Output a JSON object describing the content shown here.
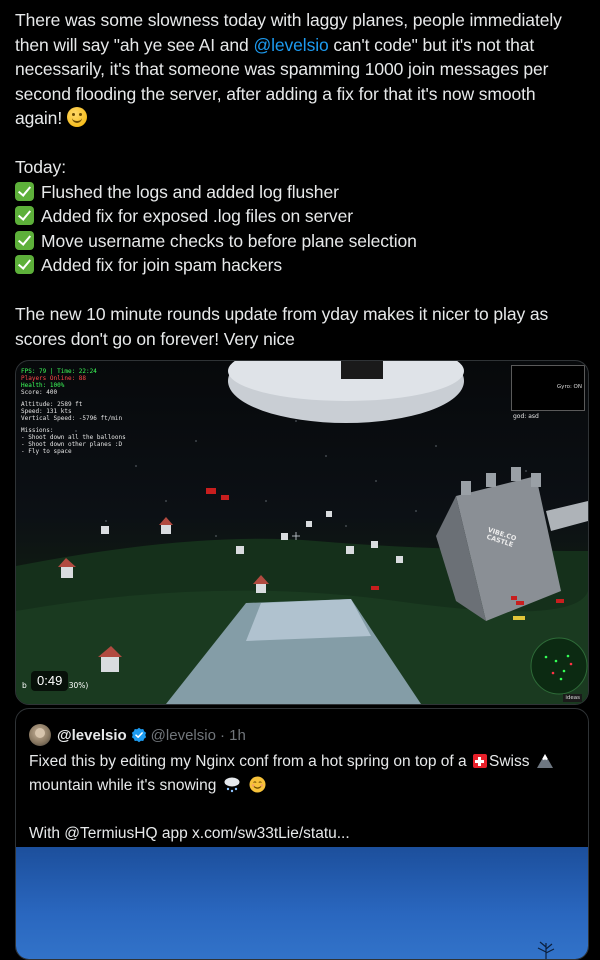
{
  "tweet": {
    "paragraph1_part1": "There was some slowness today with laggy planes, people immediately then will say \"ah ye see AI and ",
    "mention": "@levelsio",
    "paragraph1_part2": " can't code\" but it's not that necessarily, it's that someone was spamming 1000 join messages per second flooding the server, after adding a fix for that it's now smooth again! ",
    "emoji": "smiling-face-icon",
    "today_heading": "Today:",
    "checklist": [
      "Flushed the logs and added log flusher",
      "Added fix for exposed .log files on server",
      "Move username checks to before plane selection",
      "Added fix for join spam hackers"
    ],
    "paragraph3": "The new 10 minute rounds update from yday makes it nicer to play as scores don't go on forever! Very nice"
  },
  "video": {
    "duration": "0:49",
    "hud": {
      "fps_line": "FPS: 79 | Time: 22:24",
      "players_line": "Players Online: 88",
      "health_line": "Health: 100%",
      "score_line": "Score: 400",
      "altitude_line": "Altitude: 2589 ft",
      "speed_line": "Speed: 131 kts",
      "vspeed_line": "Vertical Speed: -5796 ft/min",
      "missions_title": "Missions:",
      "missions": [
        "- Shoot down all the balloons",
        "- Shoot down other planes :D",
        "- Fly to space"
      ]
    },
    "gyro_label": "Gyro: ON",
    "god_label": "god: asd",
    "castle_label_line1": "VIBE.CO",
    "castle_label_line2": "CASTLE",
    "bottom_left_prefix": "b",
    "bottom_left_suffix": "30%)",
    "ideas_label": "ideas"
  },
  "quote": {
    "name": "@levelsio",
    "handle": "@levelsio",
    "time": "· 1h",
    "line1_part1": "Fixed this by editing my Nginx conf from a hot spring on top of a ",
    "line1_part2": "Swiss",
    "line2_part1": "mountain while it's snowing",
    "line3": "With @TermiusHQ app  x.com/sw33tLie/statu..."
  },
  "colors": {
    "background": "#000000",
    "text": "#e7e9ea",
    "link": "#1d9bf0",
    "muted": "#71767b",
    "border": "#2f3336",
    "check": "#5db03a"
  }
}
